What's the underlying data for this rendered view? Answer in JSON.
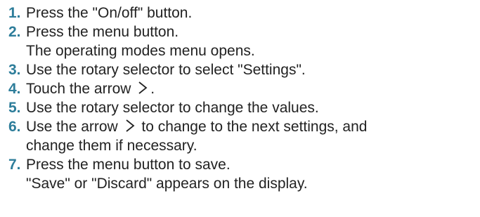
{
  "instructions": {
    "steps": [
      {
        "number": "1.",
        "lines": [
          "Press the \"On/off\" button."
        ]
      },
      {
        "number": "2.",
        "lines": [
          "Press the menu button.",
          "The operating modes menu opens."
        ]
      },
      {
        "number": "3.",
        "lines": [
          "Use the rotary selector to select \"Settings\"."
        ]
      },
      {
        "number": "4.",
        "text_before": "Touch the arrow",
        "text_after": "."
      },
      {
        "number": "5.",
        "lines": [
          "Use the rotary selector to change the values."
        ]
      },
      {
        "number": "6.",
        "text_before": "Use the arrow",
        "text_after": "to change to the next settings, and",
        "lines": [
          "change them if necessary."
        ]
      },
      {
        "number": "7.",
        "lines": [
          "Press the menu button to save.",
          "\"Save\" or \"Discard\" appears on the display."
        ]
      }
    ],
    "colors": {
      "step_number": "#2d7d9a",
      "text": "#222222"
    },
    "icons": {
      "arrow": "chevron-right-icon"
    }
  }
}
